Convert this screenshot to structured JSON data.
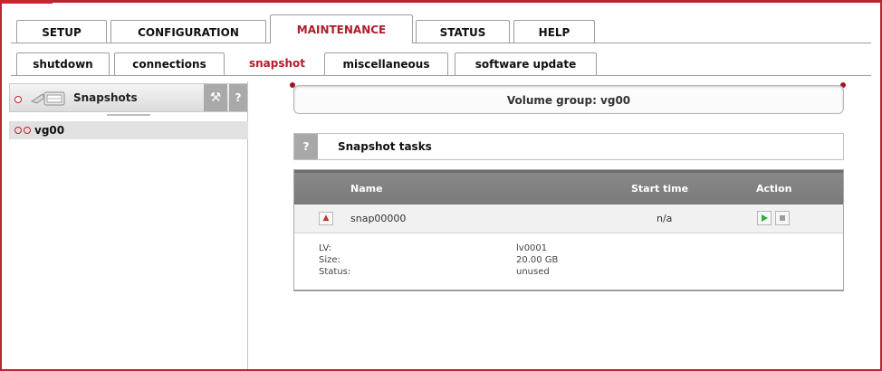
{
  "main_tabs": [
    "SETUP",
    "CONFIGURATION",
    "MAINTENANCE",
    "STATUS",
    "HELP"
  ],
  "main_active": "MAINTENANCE",
  "sub_tabs": [
    "shutdown",
    "connections",
    "snapshot",
    "miscellaneous",
    "software update"
  ],
  "sub_active": "snapshot",
  "left_panel": {
    "title": "Snapshots",
    "wrench_icon": "wrench-icon",
    "help_label": "?",
    "tree_item": "vg00"
  },
  "volume_group": "Volume group: vg00",
  "tasks": {
    "help_label": "?",
    "title": "Snapshot tasks"
  },
  "table": {
    "headers": {
      "name": "Name",
      "start": "Start time",
      "action": "Action"
    },
    "row": {
      "name": "snap00000",
      "start": "n/a"
    },
    "details": [
      {
        "label": "LV:",
        "value": "lv0001"
      },
      {
        "label": "Size:",
        "value": "20.00 GB"
      },
      {
        "label": "Status:",
        "value": "unused"
      }
    ]
  },
  "colors": {
    "accent": "#b01d2a",
    "header_gray": "#888888"
  }
}
